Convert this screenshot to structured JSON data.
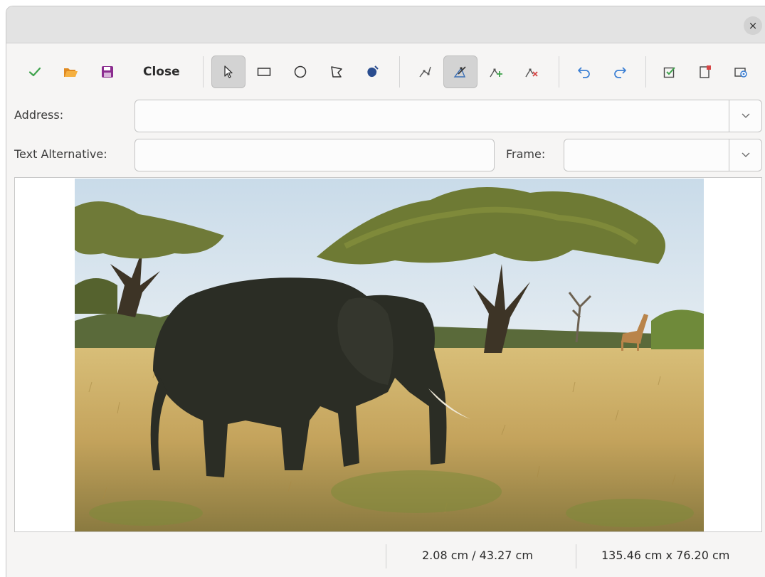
{
  "window": {
    "close_glyph": "×"
  },
  "toolbar": {
    "apply_icon": "checkmark-icon",
    "open_icon": "folder-open-icon",
    "save_icon": "floppy-save-icon",
    "close_label": "Close",
    "select_icon": "pointer-select-icon",
    "rectangle_icon": "rectangle-icon",
    "ellipse_icon": "ellipse-icon",
    "polygon_icon": "polygon-icon",
    "freeform_icon": "freeform-polygon-icon",
    "edit_points_icon": "edit-points-icon",
    "move_points_icon": "move-points-icon",
    "insert_points_icon": "insert-points-icon",
    "delete_points_icon": "delete-points-icon",
    "undo_icon": "undo-icon",
    "redo_icon": "redo-icon",
    "active_icon": "active-checkbox-icon",
    "macro_icon": "macro-icon",
    "properties_icon": "properties-icon",
    "active_tool": "move-points"
  },
  "form": {
    "address_label": "Address:",
    "address_value": "",
    "text_alt_label": "Text Alternative:",
    "text_alt_value": "",
    "frame_label": "Frame:",
    "frame_value": ""
  },
  "status": {
    "position": "2.08 cm / 43.27 cm",
    "size": "135.46 cm x 76.20 cm"
  },
  "colors": {
    "accent_green": "#3fa34d",
    "folder_orange": "#f0a030",
    "save_purple": "#8b2c8f",
    "undo_blue": "#3b7fd4",
    "delete_red": "#d64545"
  }
}
